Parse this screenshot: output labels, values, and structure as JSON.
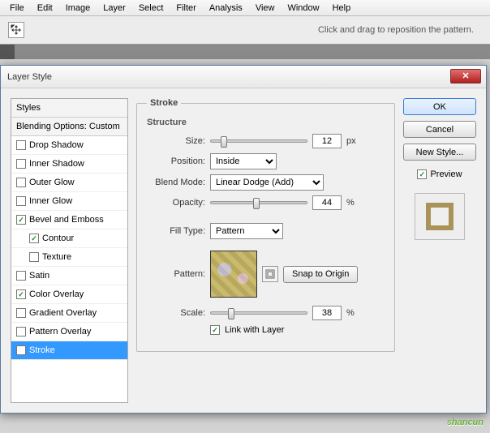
{
  "menu": [
    "File",
    "Edit",
    "Image",
    "Layer",
    "Select",
    "Filter",
    "Analysis",
    "View",
    "Window",
    "Help"
  ],
  "toolbar": {
    "hint": "Click and drag to reposition the pattern."
  },
  "dialog": {
    "title": "Layer Style",
    "styles_header": "Styles",
    "blending": "Blending Options: Custom",
    "items": [
      {
        "label": "Drop Shadow",
        "checked": false,
        "indent": false
      },
      {
        "label": "Inner Shadow",
        "checked": false,
        "indent": false
      },
      {
        "label": "Outer Glow",
        "checked": false,
        "indent": false
      },
      {
        "label": "Inner Glow",
        "checked": false,
        "indent": false
      },
      {
        "label": "Bevel and Emboss",
        "checked": true,
        "indent": false
      },
      {
        "label": "Contour",
        "checked": true,
        "indent": true
      },
      {
        "label": "Texture",
        "checked": false,
        "indent": true
      },
      {
        "label": "Satin",
        "checked": false,
        "indent": false
      },
      {
        "label": "Color Overlay",
        "checked": true,
        "indent": false
      },
      {
        "label": "Gradient Overlay",
        "checked": false,
        "indent": false
      },
      {
        "label": "Pattern Overlay",
        "checked": false,
        "indent": false
      },
      {
        "label": "Stroke",
        "checked": true,
        "indent": false,
        "selected": true
      }
    ],
    "panel_title": "Stroke",
    "structure_label": "Structure",
    "size_label": "Size:",
    "size_value": "12",
    "size_unit": "px",
    "size_pct": 10,
    "position_label": "Position:",
    "position_value": "Inside",
    "blendmode_label": "Blend Mode:",
    "blendmode_value": "Linear Dodge (Add)",
    "opacity_label": "Opacity:",
    "opacity_value": "44",
    "opacity_unit": "%",
    "opacity_pct": 44,
    "filltype_label": "Fill Type:",
    "filltype_value": "Pattern",
    "pattern_label": "Pattern:",
    "snap_label": "Snap to Origin",
    "scale_label": "Scale:",
    "scale_value": "38",
    "scale_unit": "%",
    "scale_pct": 18,
    "link_label": "Link with Layer",
    "link_checked": true,
    "ok": "OK",
    "cancel": "Cancel",
    "newstyle": "New Style...",
    "preview": "Preview",
    "preview_checked": true
  },
  "watermark": "shancun"
}
